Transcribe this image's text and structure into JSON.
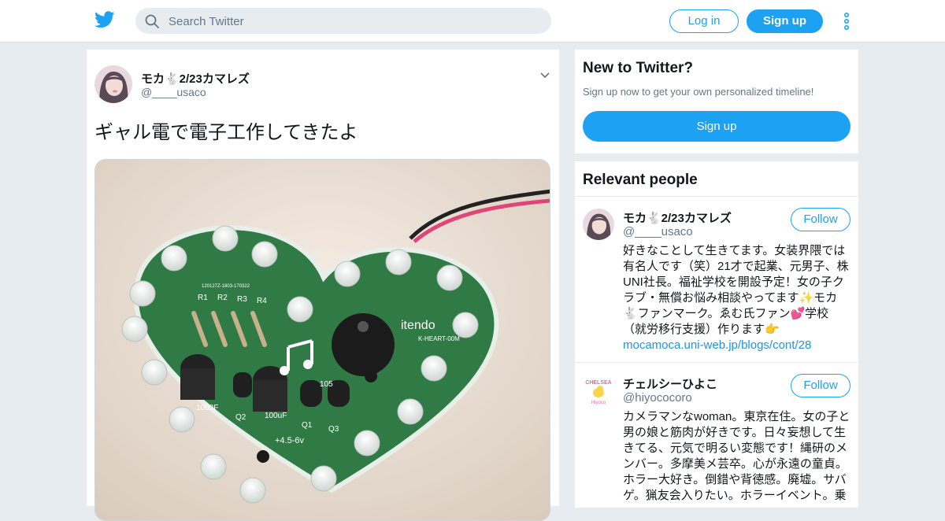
{
  "header": {
    "logo_icon": "twitter-bird-icon",
    "search_placeholder": "Search Twitter",
    "login_label": "Log in",
    "signup_label": "Sign up",
    "more_icon": "vertical-ellipsis-icon",
    "brand_color": "#1da1f2"
  },
  "tweet": {
    "author_name": "モカ🐇2/23カマレズ",
    "author_handle": "@____usaco",
    "text": "ギャル電で電子工作してきたよ",
    "media": {
      "type": "photo",
      "board_labels": [
        "R1",
        "R2",
        "R3",
        "R4",
        "itendo",
        "1000F",
        "Q2",
        "100uF",
        "Q1",
        "Q3",
        "105",
        "+4.5-6v",
        "K-HEART-00M",
        "120127Z-1803-170322"
      ]
    }
  },
  "signup_card": {
    "title": "New to Twitter?",
    "subtitle": "Sign up now to get your own personalized timeline!",
    "button_label": "Sign up"
  },
  "relevant_people": {
    "title": "Relevant people",
    "people": [
      {
        "name": "モカ🐇2/23カマレズ",
        "handle": "@____usaco",
        "follow_label": "Follow",
        "bio_lines": [
          "好きなことして生きてます。女装界隈では",
          "有名人です（笑）21才で起業、元男子、株",
          "UNI社長。福祉学校を開設予定！女の子ク",
          "ラブ・無償お悩み相談やってます✨モカ",
          "🐇ファンマーク。ゑむ氏ファン💕学校",
          "（就労移行支援）作ります👉"
        ],
        "link": "mocamoca.uni-web.jp/blogs/cont/28"
      },
      {
        "name": "チェルシーひよこ",
        "handle": "@hiyococoro",
        "follow_label": "Follow",
        "avatar_text_top": "CHELSEA",
        "avatar_text_bottom": "Hiyoco",
        "bio_lines": [
          "カメラマンなwoman。東京在住。女の子と",
          "男の娘と筋肉が好きです。日々妄想して生",
          "きてる、元気で明るい変態です！縄研のメ",
          "ンバー。多摩美メ芸卒。心が永遠の童貞。",
          "ホラー大好き。倒錯や背徳感。廃墟。サバ",
          "ゲ。猟友会入りたい。ホラーイベント。乗"
        ],
        "link": ""
      }
    ]
  }
}
